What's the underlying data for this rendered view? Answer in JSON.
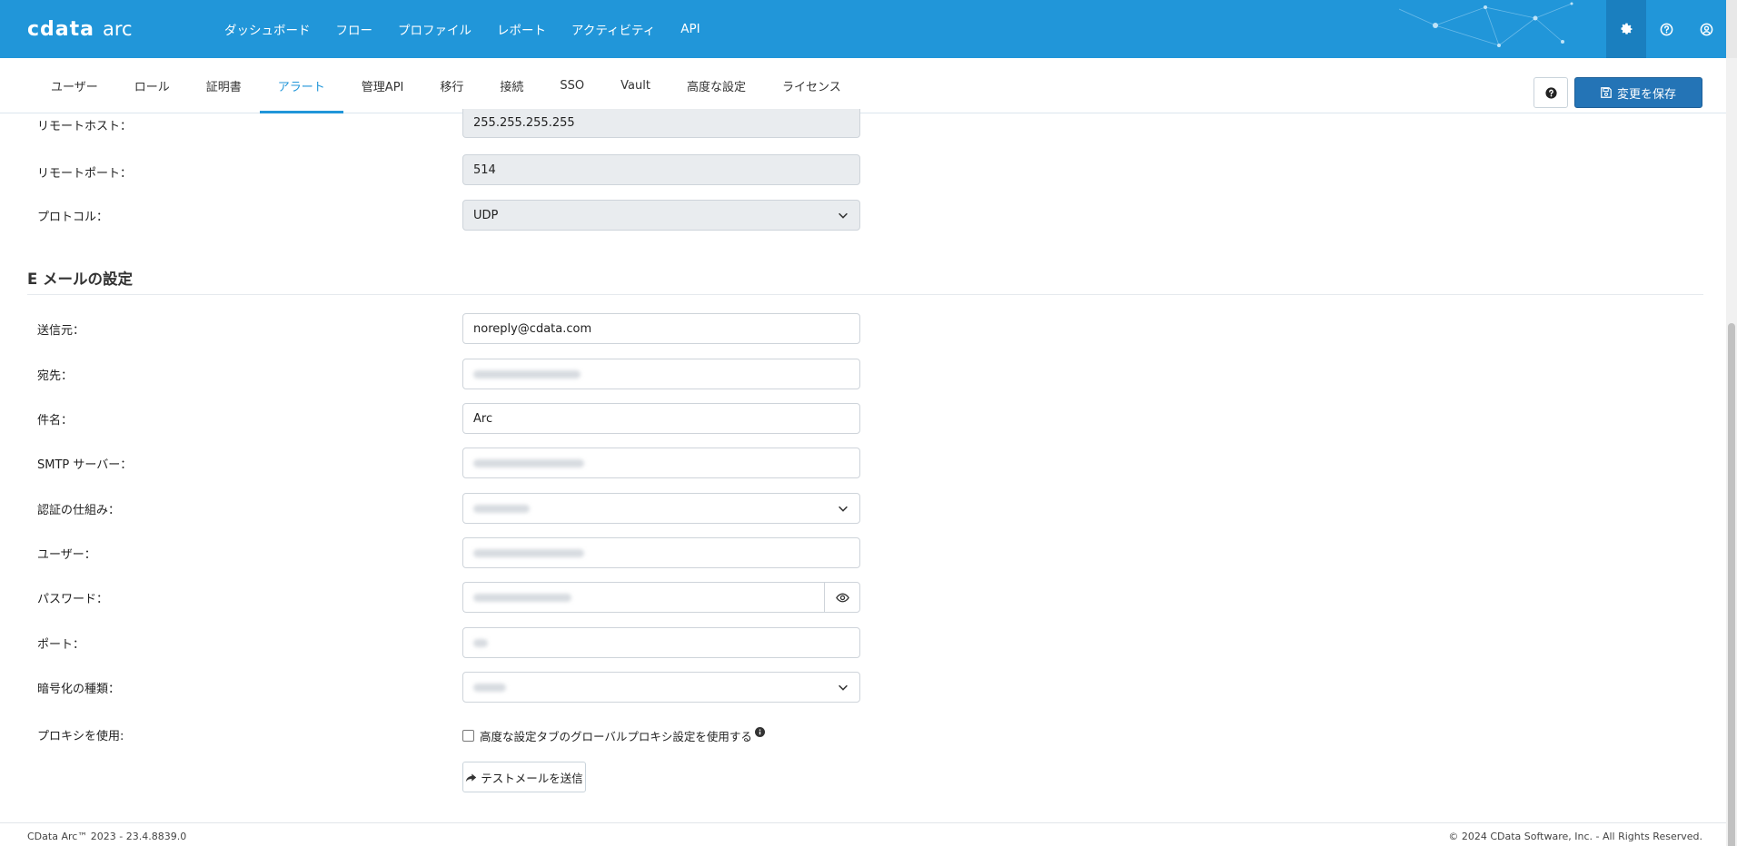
{
  "header": {
    "logo_cdata": "cdata",
    "logo_arc": "arc",
    "nav": [
      "ダッシュボード",
      "フロー",
      "プロファイル",
      "レポート",
      "アクティビティ",
      "API"
    ],
    "icons": [
      "gear-icon",
      "help-circle-icon",
      "user-circle-icon"
    ]
  },
  "subnav": {
    "tabs": [
      "ユーザー",
      "ロール",
      "証明書",
      "アラート",
      "管理API",
      "移行",
      "接続",
      "SSO",
      "Vault",
      "高度な設定",
      "ライセンス"
    ],
    "active_tab": "アラート",
    "save_label": "変更を保存"
  },
  "syslog": {
    "remote_host_label": "リモートホスト：",
    "remote_host_value": "255.255.255.255",
    "remote_port_label": "リモートポート：",
    "remote_port_value": "514",
    "protocol_label": "プロトコル：",
    "protocol_value": "UDP"
  },
  "email": {
    "section_title": "E メールの設定",
    "from_label": "送信元：",
    "from_value": "noreply@cdata.com",
    "to_label": "宛先：",
    "subject_label": "件名：",
    "subject_value": "Arc",
    "smtp_label": "SMTP サーバー：",
    "auth_label": "認証の仕組み：",
    "user_label": "ユーザー：",
    "password_label": "パスワード：",
    "port_label": "ポート：",
    "encryption_label": "暗号化の種類：",
    "proxy_label": "プロキシを使用:",
    "proxy_checkbox_label": "高度な設定タブのグローバルプロキシ設定を使用する",
    "proxy_checked": false,
    "test_button_label": "テストメールを送信"
  },
  "footer": {
    "version": "CData Arc™ 2023 - 23.4.8839.0",
    "copyright": "© 2024 CData Software, Inc. - All Rights Reserved."
  },
  "colors": {
    "header_bg": "#2196d9",
    "accent": "#2196d9",
    "save_button": "#2474b6"
  }
}
